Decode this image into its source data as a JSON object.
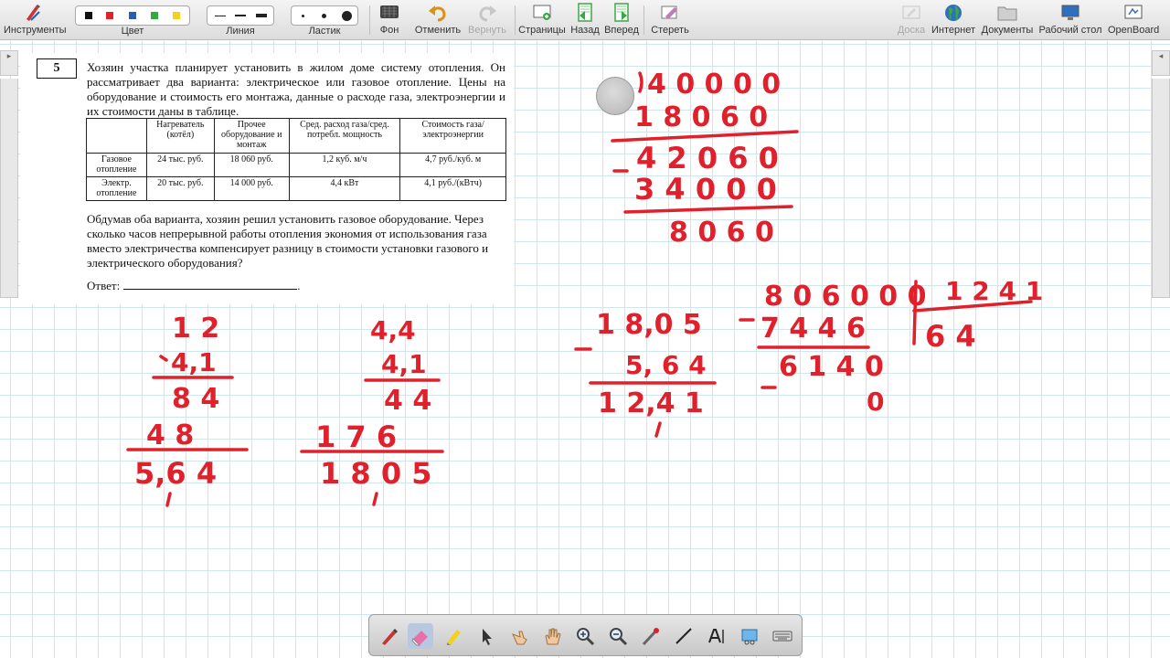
{
  "toolbar": {
    "tools_label": "Инструменты",
    "color_label": "Цвет",
    "line_label": "Линия",
    "eraser_label": "Ластик",
    "background_label": "Фон",
    "undo_label": "Отменить",
    "redo_label": "Вернуть",
    "pages_label": "Страницы",
    "back_label": "Назад",
    "forward_label": "Вперед",
    "clear_label": "Стереть",
    "board_label": "Доска",
    "internet_label": "Интернет",
    "documents_label": "Документы",
    "desktop_label": "Рабочий стол",
    "openboard_label": "OpenBoard",
    "colors": [
      "#111111",
      "#e0202a",
      "#2a5db0",
      "#2faa3c",
      "#f2d21b"
    ]
  },
  "task": {
    "number": "5",
    "text": "Хозяин участка планирует установить в жилом доме систему отопления. Он рассматривает два варианта: электрическое или газовое отопление. Цены на оборудование и стоимость его монтажа, данные о расходе газа, электроэнергии и их стоимости даны в таблице.",
    "table": {
      "headers": [
        "",
        "Нагреватель (котёл)",
        "Прочее оборудование и монтаж",
        "Сред. расход газа/сред. потребл. мощность",
        "Стоимость газа/электроэнергии"
      ],
      "rows": [
        [
          "Газовое отопление",
          "24 тыс. руб.",
          "18 060 руб.",
          "1,2 куб. м/ч",
          "4,7 руб./куб. м"
        ],
        [
          "Электр. отопление",
          "20 тыс. руб.",
          "14 000 руб.",
          "4,4 кВт",
          "4,1 руб./(кВтч)"
        ]
      ]
    },
    "question": "Обдумав оба варианта, хозяин решил установить газовое оборудование. Через сколько часов непрерывной работы отопления экономия от использования газа вместо электричества компенсирует разницу в стоимости установки газового и электрического оборудования?",
    "answer_label": "Ответ:"
  },
  "ink": {
    "calc_a": {
      "top": "1 2",
      "mult": "4,1",
      "p1": "8 4",
      "p2": "4 8",
      "result": "5,6 4"
    },
    "calc_b": {
      "top": "4,4",
      "mult": "4,1",
      "p1": "4 4",
      "p2": "1 7 6",
      "result": "1 8 0 5"
    },
    "calc_c": {
      "top": "1 8,0 5",
      "sub": "5, 6 4",
      "result": "1 2,4 1"
    },
    "calc_d": {
      "l1": "4 0 0 0 0",
      "l2": "1 8 0 6 0",
      "l3": "4 2 0 6 0",
      "l4": "3 4 0 0 0",
      "l5": "8 0 6 0"
    },
    "calc_e": {
      "dividend": "8 0 6 0 0 0",
      "divisor": "1 2 4 1",
      "sub1": "7 4 4 6",
      "quotient": "6 4",
      "rem1": "6 1 4 0",
      "rem2": "0"
    }
  }
}
